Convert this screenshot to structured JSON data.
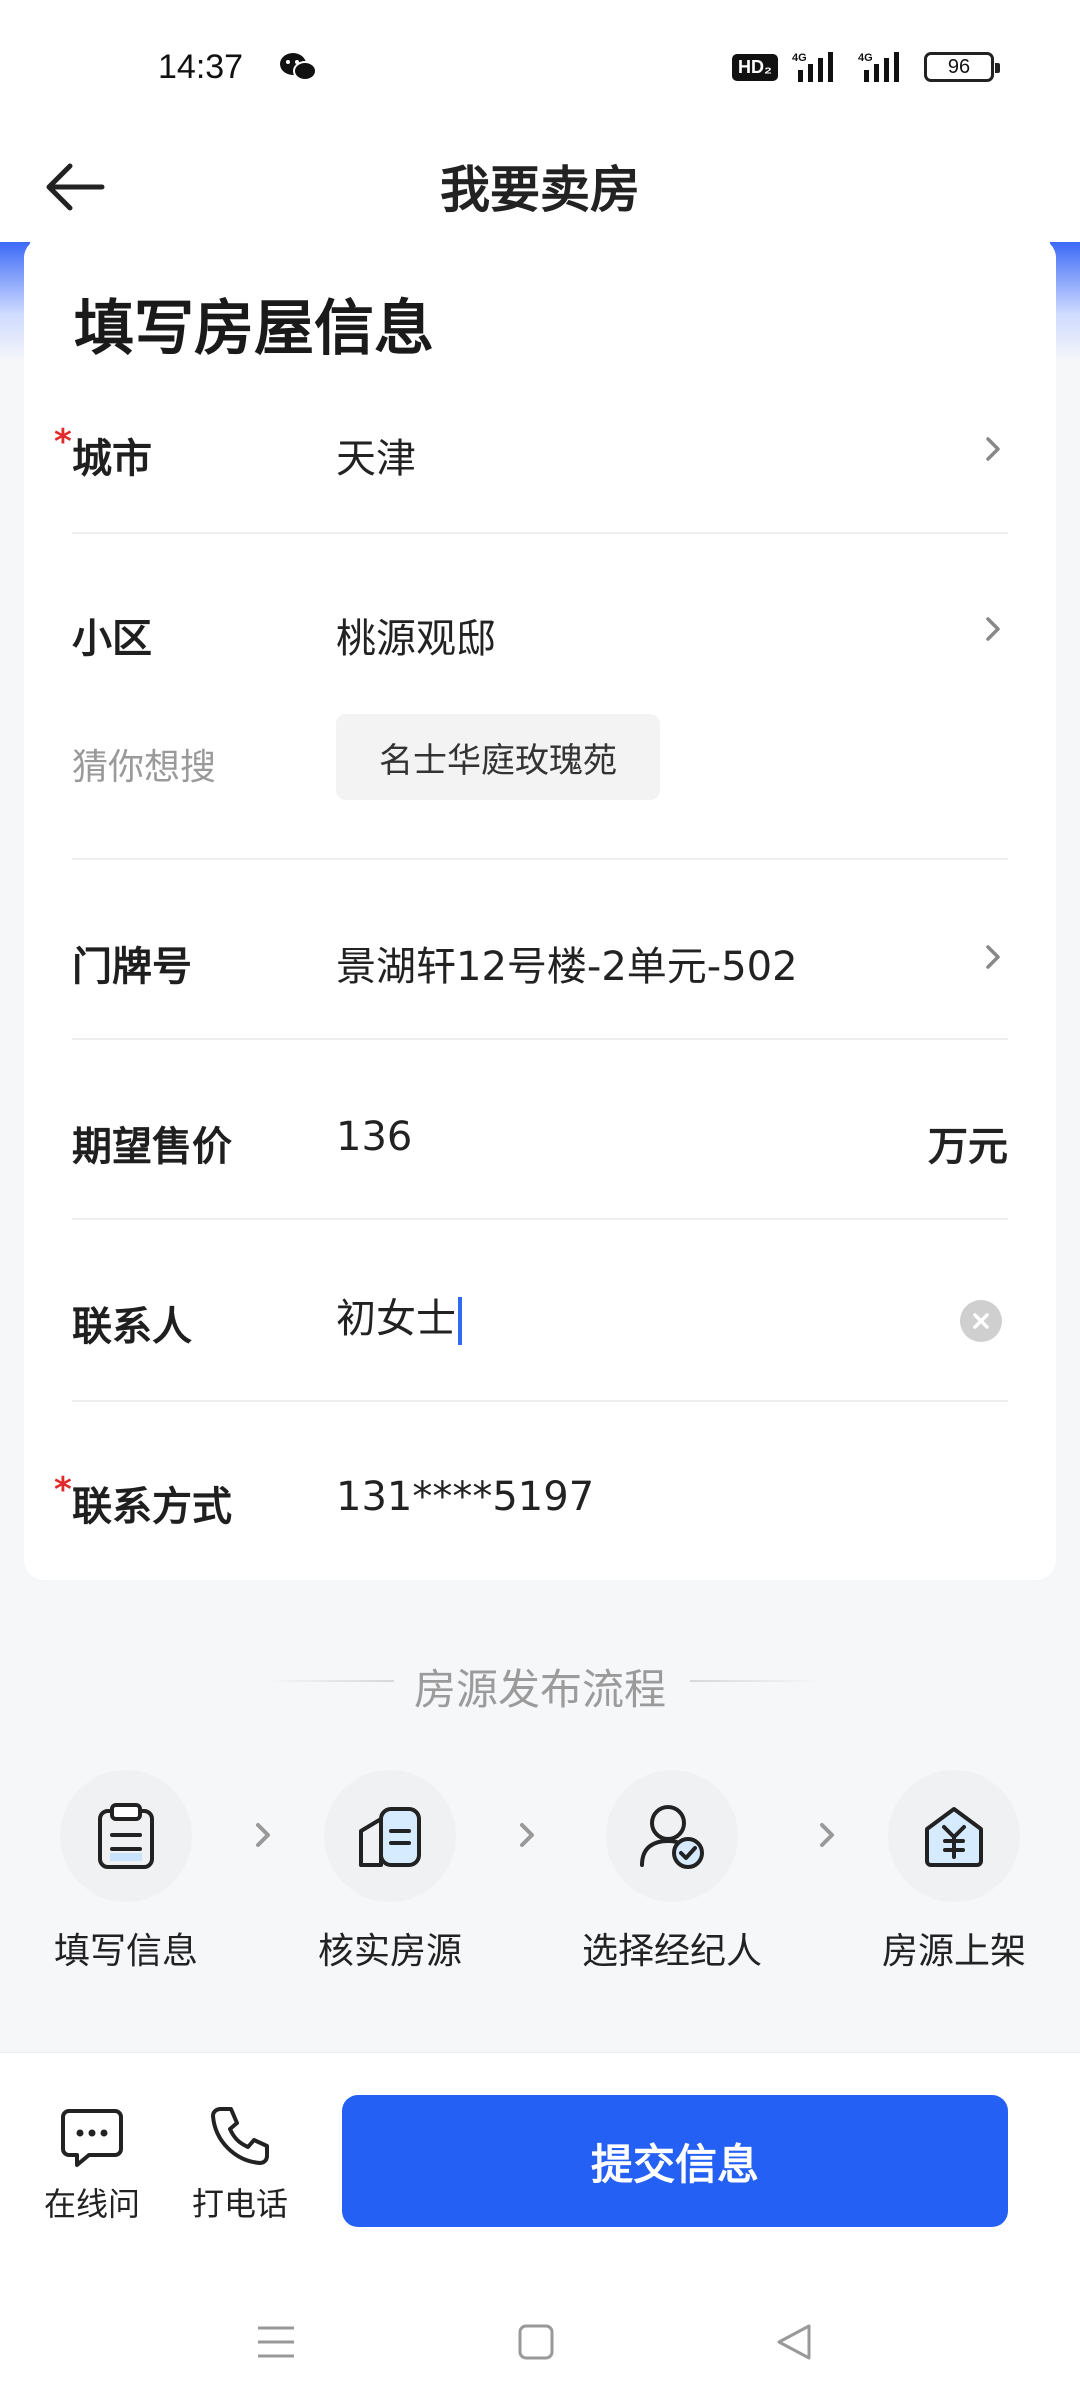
{
  "status_bar": {
    "time": "14:37",
    "network_hd": "HD₂",
    "signal1": "4G",
    "signal2": "4G",
    "battery": "96"
  },
  "header": {
    "title": "我要卖房",
    "back_icon": "arrow-left-icon"
  },
  "form": {
    "title": "填写房屋信息",
    "city": {
      "label": "城市",
      "value": "天津",
      "required": true
    },
    "community": {
      "label": "小区",
      "value": "桃源观邸"
    },
    "suggest": {
      "label": "猜你想搜",
      "chip": "名士华庭玫瑰苑"
    },
    "house_number": {
      "label": "门牌号",
      "value": "景湖轩12号楼-2单元-502"
    },
    "price": {
      "label": "期望售价",
      "value": "136",
      "unit": "万元"
    },
    "contact": {
      "label": "联系人",
      "value": "初女士"
    },
    "phone": {
      "label": "联系方式",
      "value": "131****5197",
      "required": true
    }
  },
  "process": {
    "title": "房源发布流程",
    "steps": [
      {
        "label": "填写信息",
        "icon": "clipboard-icon"
      },
      {
        "label": "核实房源",
        "icon": "building-doc-icon"
      },
      {
        "label": "选择经纪人",
        "icon": "agent-check-icon"
      },
      {
        "label": "房源上架",
        "icon": "house-yuan-icon"
      }
    ]
  },
  "actions": {
    "chat_label": "在线问",
    "call_label": "打电话",
    "submit_label": "提交信息"
  },
  "colors": {
    "primary": "#2460f4",
    "required": "#e02b2b",
    "caret": "#2f6af0"
  }
}
